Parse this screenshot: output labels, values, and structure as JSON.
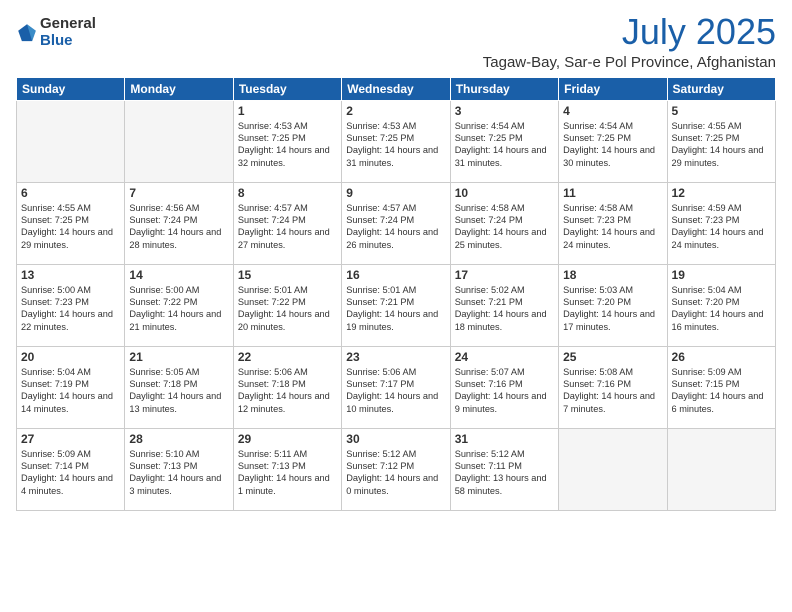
{
  "logo": {
    "general": "General",
    "blue": "Blue"
  },
  "header": {
    "month": "July 2025",
    "location": "Tagaw-Bay, Sar-e Pol Province, Afghanistan"
  },
  "weekdays": [
    "Sunday",
    "Monday",
    "Tuesday",
    "Wednesday",
    "Thursday",
    "Friday",
    "Saturday"
  ],
  "weeks": [
    [
      {
        "day": "",
        "text": ""
      },
      {
        "day": "",
        "text": ""
      },
      {
        "day": "1",
        "text": "Sunrise: 4:53 AM\nSunset: 7:25 PM\nDaylight: 14 hours and 32 minutes."
      },
      {
        "day": "2",
        "text": "Sunrise: 4:53 AM\nSunset: 7:25 PM\nDaylight: 14 hours and 31 minutes."
      },
      {
        "day": "3",
        "text": "Sunrise: 4:54 AM\nSunset: 7:25 PM\nDaylight: 14 hours and 31 minutes."
      },
      {
        "day": "4",
        "text": "Sunrise: 4:54 AM\nSunset: 7:25 PM\nDaylight: 14 hours and 30 minutes."
      },
      {
        "day": "5",
        "text": "Sunrise: 4:55 AM\nSunset: 7:25 PM\nDaylight: 14 hours and 29 minutes."
      }
    ],
    [
      {
        "day": "6",
        "text": "Sunrise: 4:55 AM\nSunset: 7:25 PM\nDaylight: 14 hours and 29 minutes."
      },
      {
        "day": "7",
        "text": "Sunrise: 4:56 AM\nSunset: 7:24 PM\nDaylight: 14 hours and 28 minutes."
      },
      {
        "day": "8",
        "text": "Sunrise: 4:57 AM\nSunset: 7:24 PM\nDaylight: 14 hours and 27 minutes."
      },
      {
        "day": "9",
        "text": "Sunrise: 4:57 AM\nSunset: 7:24 PM\nDaylight: 14 hours and 26 minutes."
      },
      {
        "day": "10",
        "text": "Sunrise: 4:58 AM\nSunset: 7:24 PM\nDaylight: 14 hours and 25 minutes."
      },
      {
        "day": "11",
        "text": "Sunrise: 4:58 AM\nSunset: 7:23 PM\nDaylight: 14 hours and 24 minutes."
      },
      {
        "day": "12",
        "text": "Sunrise: 4:59 AM\nSunset: 7:23 PM\nDaylight: 14 hours and 24 minutes."
      }
    ],
    [
      {
        "day": "13",
        "text": "Sunrise: 5:00 AM\nSunset: 7:23 PM\nDaylight: 14 hours and 22 minutes."
      },
      {
        "day": "14",
        "text": "Sunrise: 5:00 AM\nSunset: 7:22 PM\nDaylight: 14 hours and 21 minutes."
      },
      {
        "day": "15",
        "text": "Sunrise: 5:01 AM\nSunset: 7:22 PM\nDaylight: 14 hours and 20 minutes."
      },
      {
        "day": "16",
        "text": "Sunrise: 5:01 AM\nSunset: 7:21 PM\nDaylight: 14 hours and 19 minutes."
      },
      {
        "day": "17",
        "text": "Sunrise: 5:02 AM\nSunset: 7:21 PM\nDaylight: 14 hours and 18 minutes."
      },
      {
        "day": "18",
        "text": "Sunrise: 5:03 AM\nSunset: 7:20 PM\nDaylight: 14 hours and 17 minutes."
      },
      {
        "day": "19",
        "text": "Sunrise: 5:04 AM\nSunset: 7:20 PM\nDaylight: 14 hours and 16 minutes."
      }
    ],
    [
      {
        "day": "20",
        "text": "Sunrise: 5:04 AM\nSunset: 7:19 PM\nDaylight: 14 hours and 14 minutes."
      },
      {
        "day": "21",
        "text": "Sunrise: 5:05 AM\nSunset: 7:18 PM\nDaylight: 14 hours and 13 minutes."
      },
      {
        "day": "22",
        "text": "Sunrise: 5:06 AM\nSunset: 7:18 PM\nDaylight: 14 hours and 12 minutes."
      },
      {
        "day": "23",
        "text": "Sunrise: 5:06 AM\nSunset: 7:17 PM\nDaylight: 14 hours and 10 minutes."
      },
      {
        "day": "24",
        "text": "Sunrise: 5:07 AM\nSunset: 7:16 PM\nDaylight: 14 hours and 9 minutes."
      },
      {
        "day": "25",
        "text": "Sunrise: 5:08 AM\nSunset: 7:16 PM\nDaylight: 14 hours and 7 minutes."
      },
      {
        "day": "26",
        "text": "Sunrise: 5:09 AM\nSunset: 7:15 PM\nDaylight: 14 hours and 6 minutes."
      }
    ],
    [
      {
        "day": "27",
        "text": "Sunrise: 5:09 AM\nSunset: 7:14 PM\nDaylight: 14 hours and 4 minutes."
      },
      {
        "day": "28",
        "text": "Sunrise: 5:10 AM\nSunset: 7:13 PM\nDaylight: 14 hours and 3 minutes."
      },
      {
        "day": "29",
        "text": "Sunrise: 5:11 AM\nSunset: 7:13 PM\nDaylight: 14 hours and 1 minute."
      },
      {
        "day": "30",
        "text": "Sunrise: 5:12 AM\nSunset: 7:12 PM\nDaylight: 14 hours and 0 minutes."
      },
      {
        "day": "31",
        "text": "Sunrise: 5:12 AM\nSunset: 7:11 PM\nDaylight: 13 hours and 58 minutes."
      },
      {
        "day": "",
        "text": ""
      },
      {
        "day": "",
        "text": ""
      }
    ]
  ]
}
